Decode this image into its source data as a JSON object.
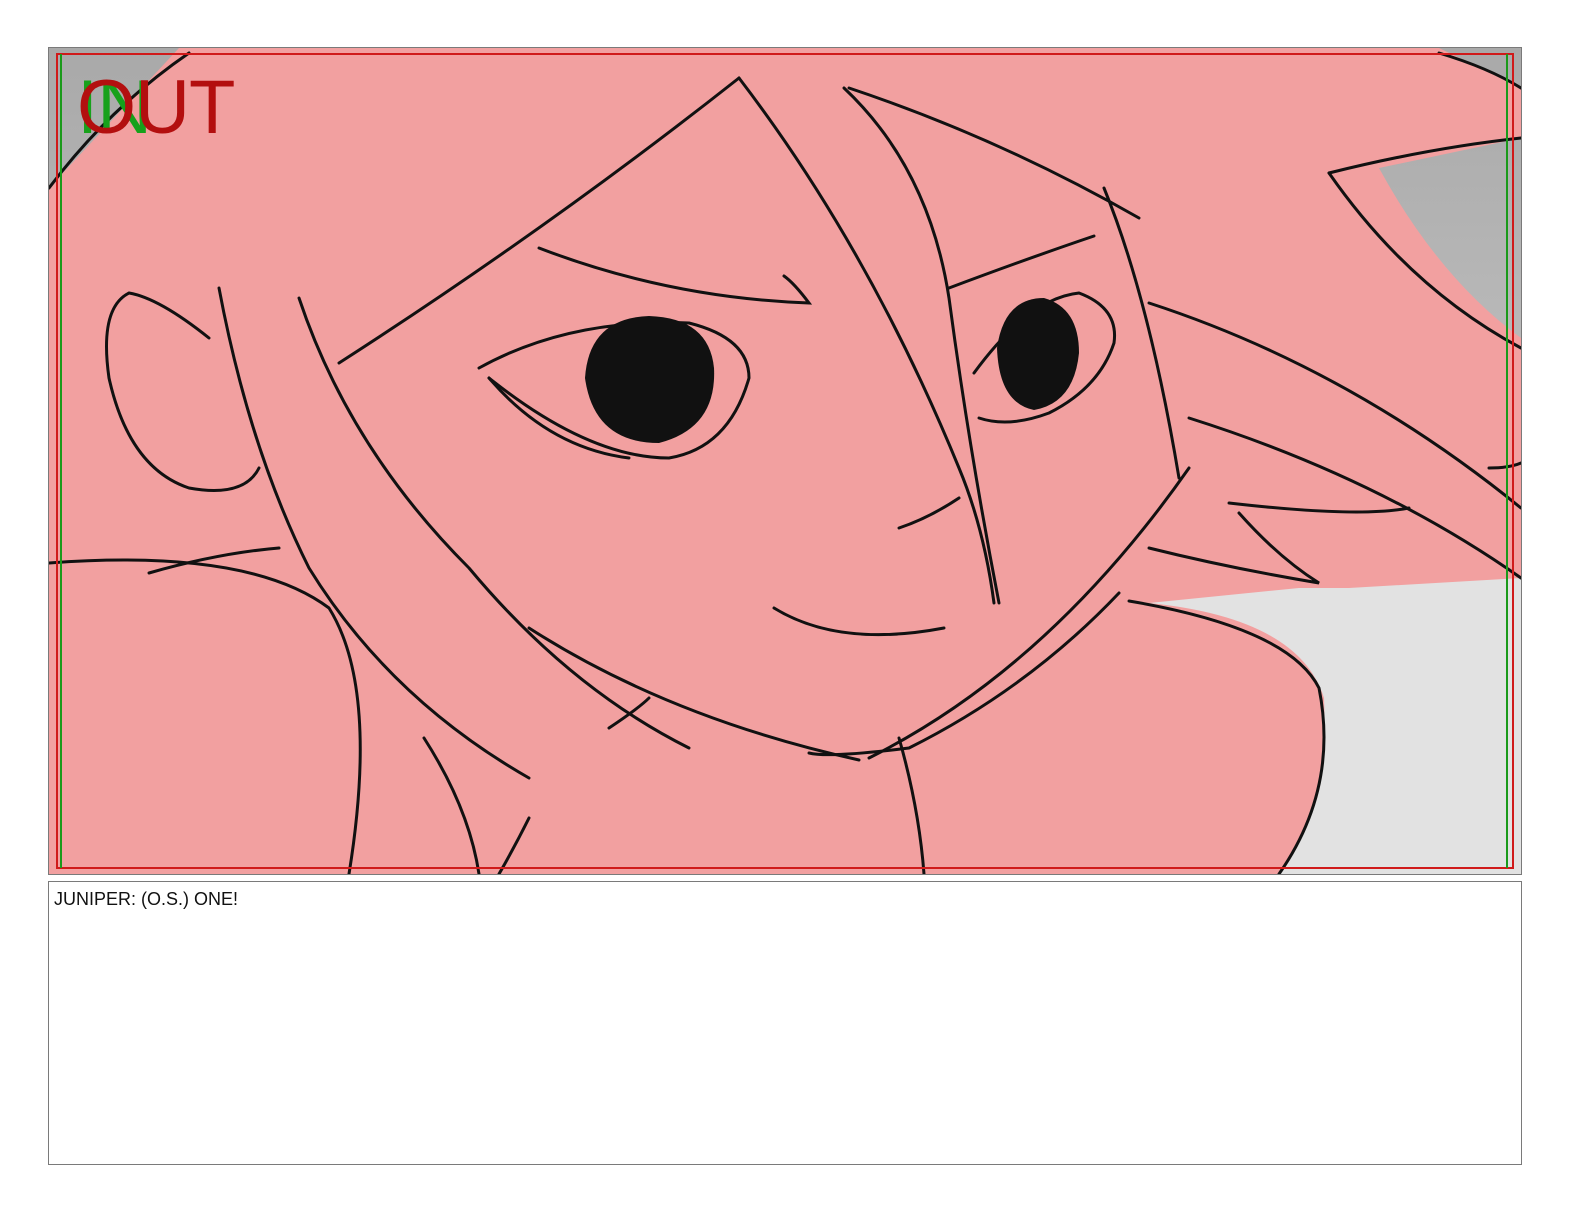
{
  "panel": {
    "in_marker": "IN",
    "out_marker": "OUT",
    "colors": {
      "in_marker": "#17a11b",
      "out_marker": "#b30f0f",
      "character_fill": "#f2a0a0",
      "background_gray": "#b8b8b8",
      "background_light": "#e2e2e2",
      "ink": "#111111",
      "safe_frame_red": "#d01a1a",
      "safe_frame_green": "#1a9a1a"
    }
  },
  "caption": {
    "dialogue": "JUNIPER: (O.S.) ONE!"
  }
}
